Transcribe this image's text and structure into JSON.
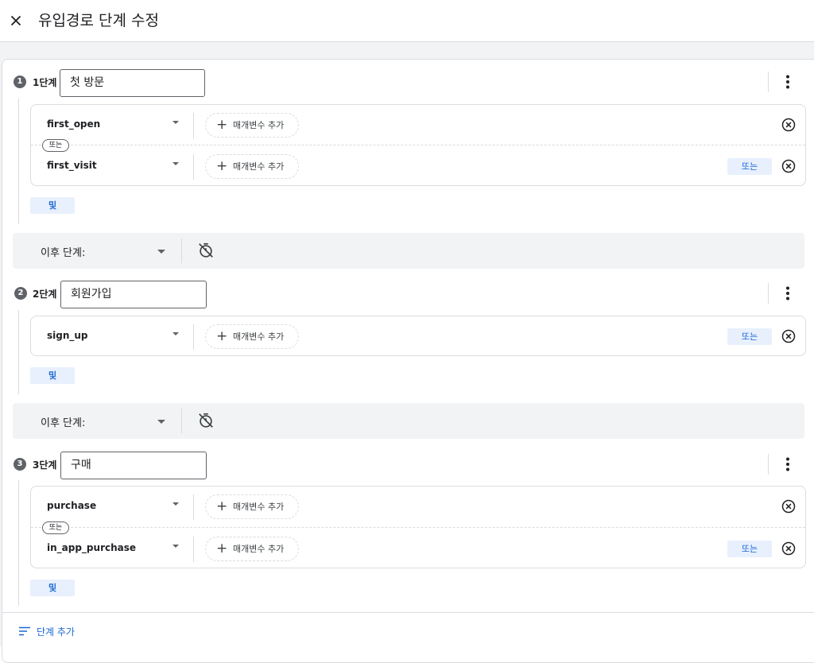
{
  "header": {
    "title": "유입경로 단계 수정"
  },
  "steps": [
    {
      "number": "1",
      "label": "1단계",
      "name": "첫 방문",
      "conditions": [
        {
          "event": "first_open",
          "param_label": "매개변수 추가"
        },
        {
          "event": "first_visit",
          "param_label": "매개변수 추가",
          "or_label": "또는"
        }
      ],
      "or_separator": "또는",
      "and_label": "및"
    },
    {
      "number": "2",
      "label": "2단계",
      "name": "회원가입",
      "conditions": [
        {
          "event": "sign_up",
          "param_label": "매개변수 추가",
          "or_label": "또는"
        }
      ],
      "and_label": "및"
    },
    {
      "number": "3",
      "label": "3단계",
      "name": "구매",
      "conditions": [
        {
          "event": "purchase",
          "param_label": "매개변수 추가"
        },
        {
          "event": "in_app_purchase",
          "param_label": "매개변수 추가",
          "or_label": "또는"
        }
      ],
      "or_separator": "또는",
      "and_label": "및"
    }
  ],
  "next_steps": [
    {
      "label": "이후 단계:"
    },
    {
      "label": "이후 단계:"
    }
  ],
  "footer": {
    "add_step_label": "단계 추가"
  },
  "colors": {
    "accent": "#1967d2",
    "chip_bg": "#e8f0fe",
    "muted": "#5f6368",
    "border": "#dadce0"
  },
  "icons": [
    "close-icon",
    "more-vert-icon",
    "add-icon",
    "cancel-icon",
    "timer-off-icon",
    "sort-icon"
  ]
}
